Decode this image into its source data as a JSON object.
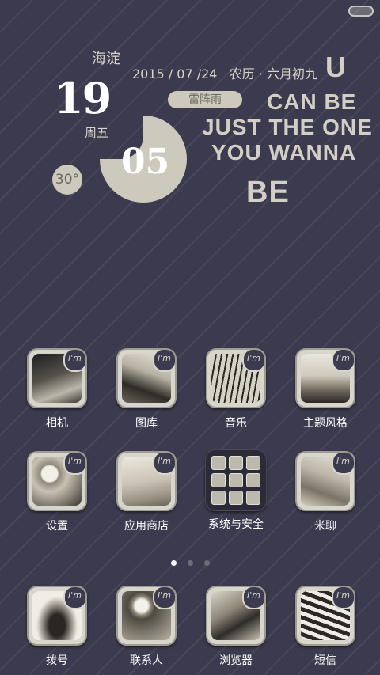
{
  "status": {
    "battery_icon": "battery-pill-icon"
  },
  "widget": {
    "district": "海淀",
    "date": "2015 / 07 /24",
    "lunar": "农历 · 六月初九",
    "day": "19",
    "weekday": "周五",
    "weather": "雷阵雨",
    "minute": "05",
    "temperature": "30°",
    "quote": {
      "u": "U",
      "line1": "CAN BE",
      "line2": "JUST THE ONE",
      "line3": "YOU WANNA",
      "be": "BE"
    }
  },
  "apps": {
    "row1": [
      {
        "label": "相机",
        "icon": "camera-photo-icon"
      },
      {
        "label": "图库",
        "icon": "gallery-photo-icon"
      },
      {
        "label": "音乐",
        "icon": "music-photo-icon"
      },
      {
        "label": "主题风格",
        "icon": "theme-photo-icon"
      }
    ],
    "row2": [
      {
        "label": "设置",
        "icon": "settings-photo-icon"
      },
      {
        "label": "应用商店",
        "icon": "app-store-photo-icon"
      },
      {
        "label": "系统与安全",
        "icon": "system-folder-icon"
      },
      {
        "label": "米聊",
        "icon": "mitalk-photo-icon"
      }
    ],
    "dock": [
      {
        "label": "拨号",
        "icon": "dialer-photo-icon"
      },
      {
        "label": "联系人",
        "icon": "contacts-photo-icon"
      },
      {
        "label": "浏览器",
        "icon": "browser-photo-icon"
      },
      {
        "label": "短信",
        "icon": "sms-photo-icon"
      }
    ]
  },
  "badge_text": "I'm",
  "page_indicator": {
    "count": 3,
    "active": 1
  },
  "colors": {
    "background": "#3b3a4e",
    "accent": "#cdc9bd",
    "text": "#d8d4ca"
  }
}
